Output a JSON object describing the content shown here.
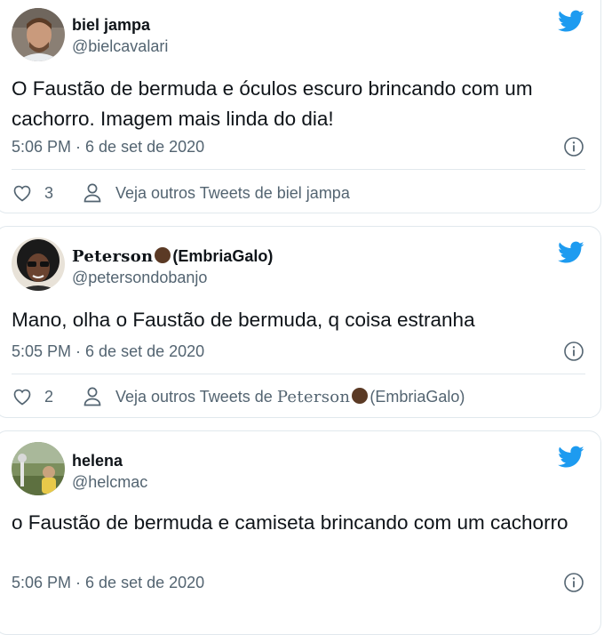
{
  "accent_color": "#1d9bf0",
  "tweets": [
    {
      "name": "biel jampa",
      "handle": "@bielcavalari",
      "text": "O Faustão de bermuda e óculos escuro brincando com um cachorro. Imagem mais linda do dia!",
      "timestamp": "5:06 PM · 6 de set de 2020",
      "likes": "3",
      "more_tweets": "Veja outros Tweets de biel jampa"
    },
    {
      "name_prefix": "Peterson",
      "name_suffix": "(EmbriaGalo)",
      "handle": "@petersondobanjo",
      "text": "Mano, olha o Faustão de bermuda, q coisa estranha",
      "timestamp": "5:05 PM · 6 de set de 2020",
      "likes": "2",
      "more_tweets_prefix": "Veja outros Tweets de",
      "more_tweets_name": "Peterson",
      "more_tweets_suffix": "(EmbriaGalo)"
    },
    {
      "name": "helena",
      "handle": "@helcmac",
      "text": "o Faustão de bermuda e camiseta brincando com um cachorro",
      "timestamp": "5:06 PM · 6 de set de 2020"
    }
  ]
}
